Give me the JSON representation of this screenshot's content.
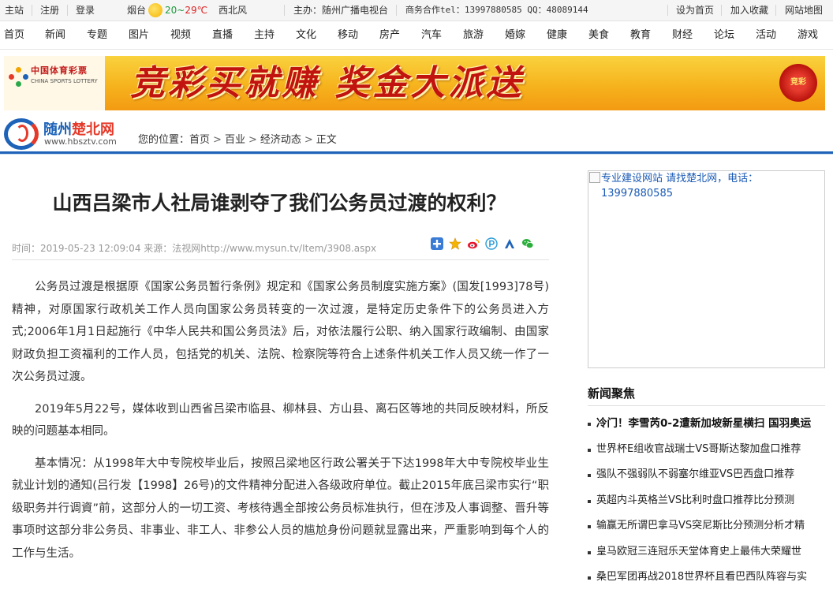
{
  "topbar": {
    "home": "主站",
    "register": "注册",
    "login": "登录",
    "city": "烟台",
    "temp_low": "20",
    "temp_sep": "~",
    "temp_high": "29℃",
    "wind": "西北风",
    "host": "主办：随州广播电视台",
    "business": "商务合作tel：13997880585 QQ：48089144",
    "set_home": "设为首页",
    "favorite": "加入收藏",
    "sitemap": "网站地图"
  },
  "nav": {
    "items": [
      "首页",
      "新闻",
      "专题",
      "图片",
      "视频",
      "直播",
      "主持",
      "文化",
      "移动",
      "房产",
      "汽车",
      "旅游",
      "婚嫁",
      "健康",
      "美食",
      "教育",
      "财经",
      "论坛",
      "活动",
      "游戏"
    ]
  },
  "banner": {
    "lottery_cn": "中国体育彩票",
    "lottery_en": "CHINA SPORTS LOTTERY",
    "slogan": "竞彩买就赚  奖金大派送",
    "badge": "竞彩"
  },
  "site": {
    "name_a": "随州",
    "name_b": "楚北网",
    "url": "www.hbsztv.com"
  },
  "breadcrumb": {
    "prefix": "您的位置：",
    "items": [
      "首页",
      "百业",
      "经济动态",
      "正文"
    ],
    "separator": ">"
  },
  "article": {
    "title": "山西吕梁市人社局谁剥夺了我们公务员过渡的权利？",
    "meta": "时间：2019-05-23 12:09:04 来源：法视网http://www.mysun.tv/Item/3908.aspx",
    "paragraphs": [
      "公务员过渡是根据原《国家公务员暂行条例》规定和《国家公务员制度实施方案》(国发[1993]78号)精神，对原国家行政机关工作人员向国家公务员转变的一次过渡，是特定历史条件下的公务员进入方式;2006年1月1日起施行《中华人民共和国公务员法》后，对依法履行公职、纳入国家行政编制、由国家财政负担工资福利的工作人员，包括党的机关、法院、检察院等符合上述条件机关工作人员又统一作了一次公务员过渡。",
      "2019年5月22号，媒体收到山西省吕梁市临县、柳林县、方山县、离石区等地的共同反映材料，所反映的问题基本相同。",
      "基本情况：从1998年大中专院校毕业后，按照吕梁地区行政公署关于下达1998年大中专院校毕业生就业计划的通知(吕行发【1998】26号)的文件精神分配进入各级政府单位。截止2015年底吕梁市实行“职级职务并行调資”前，这部分人的一切工资、考核待遇全部按公务员标准执行，但在涉及人事调整、晋升等事项时这部分非公务员、非事业、非工人、非参公人员的尴尬身份问题就显露出来，严重影响到每个人的工作与生活。"
    ],
    "share_icons": [
      "plus-share-icon",
      "star-share-icon",
      "weibo-icon",
      "p-share-icon",
      "people-share-icon",
      "wechat-icon"
    ]
  },
  "sidebar": {
    "ad_text": "专业建设网站 请找楚北网，电话：13997880585",
    "focus_title": "新闻聚焦",
    "focus_items": [
      "冷门！李雪芮0-2遭新加坡新星横扫 国羽奥运",
      "世界杯E组收官战瑞士VS哥斯达黎加盘口推荐",
      "强队不强弱队不弱塞尔维亚VS巴西盘口推荐",
      "英超内斗英格兰VS比利时盘口推荐比分预测",
      "输赢无所谓巴拿马VS突尼斯比分预测分析才精",
      "皇马欧冠三连冠乐天堂体育史上最伟大荣耀世",
      "桑巴军团再战2018世界杯且看巴西队阵容与实"
    ]
  },
  "colors": {
    "accent_blue": "#1e63b8",
    "accent_red": "#e53a2a",
    "banner_yellow": "#f6b31d"
  }
}
